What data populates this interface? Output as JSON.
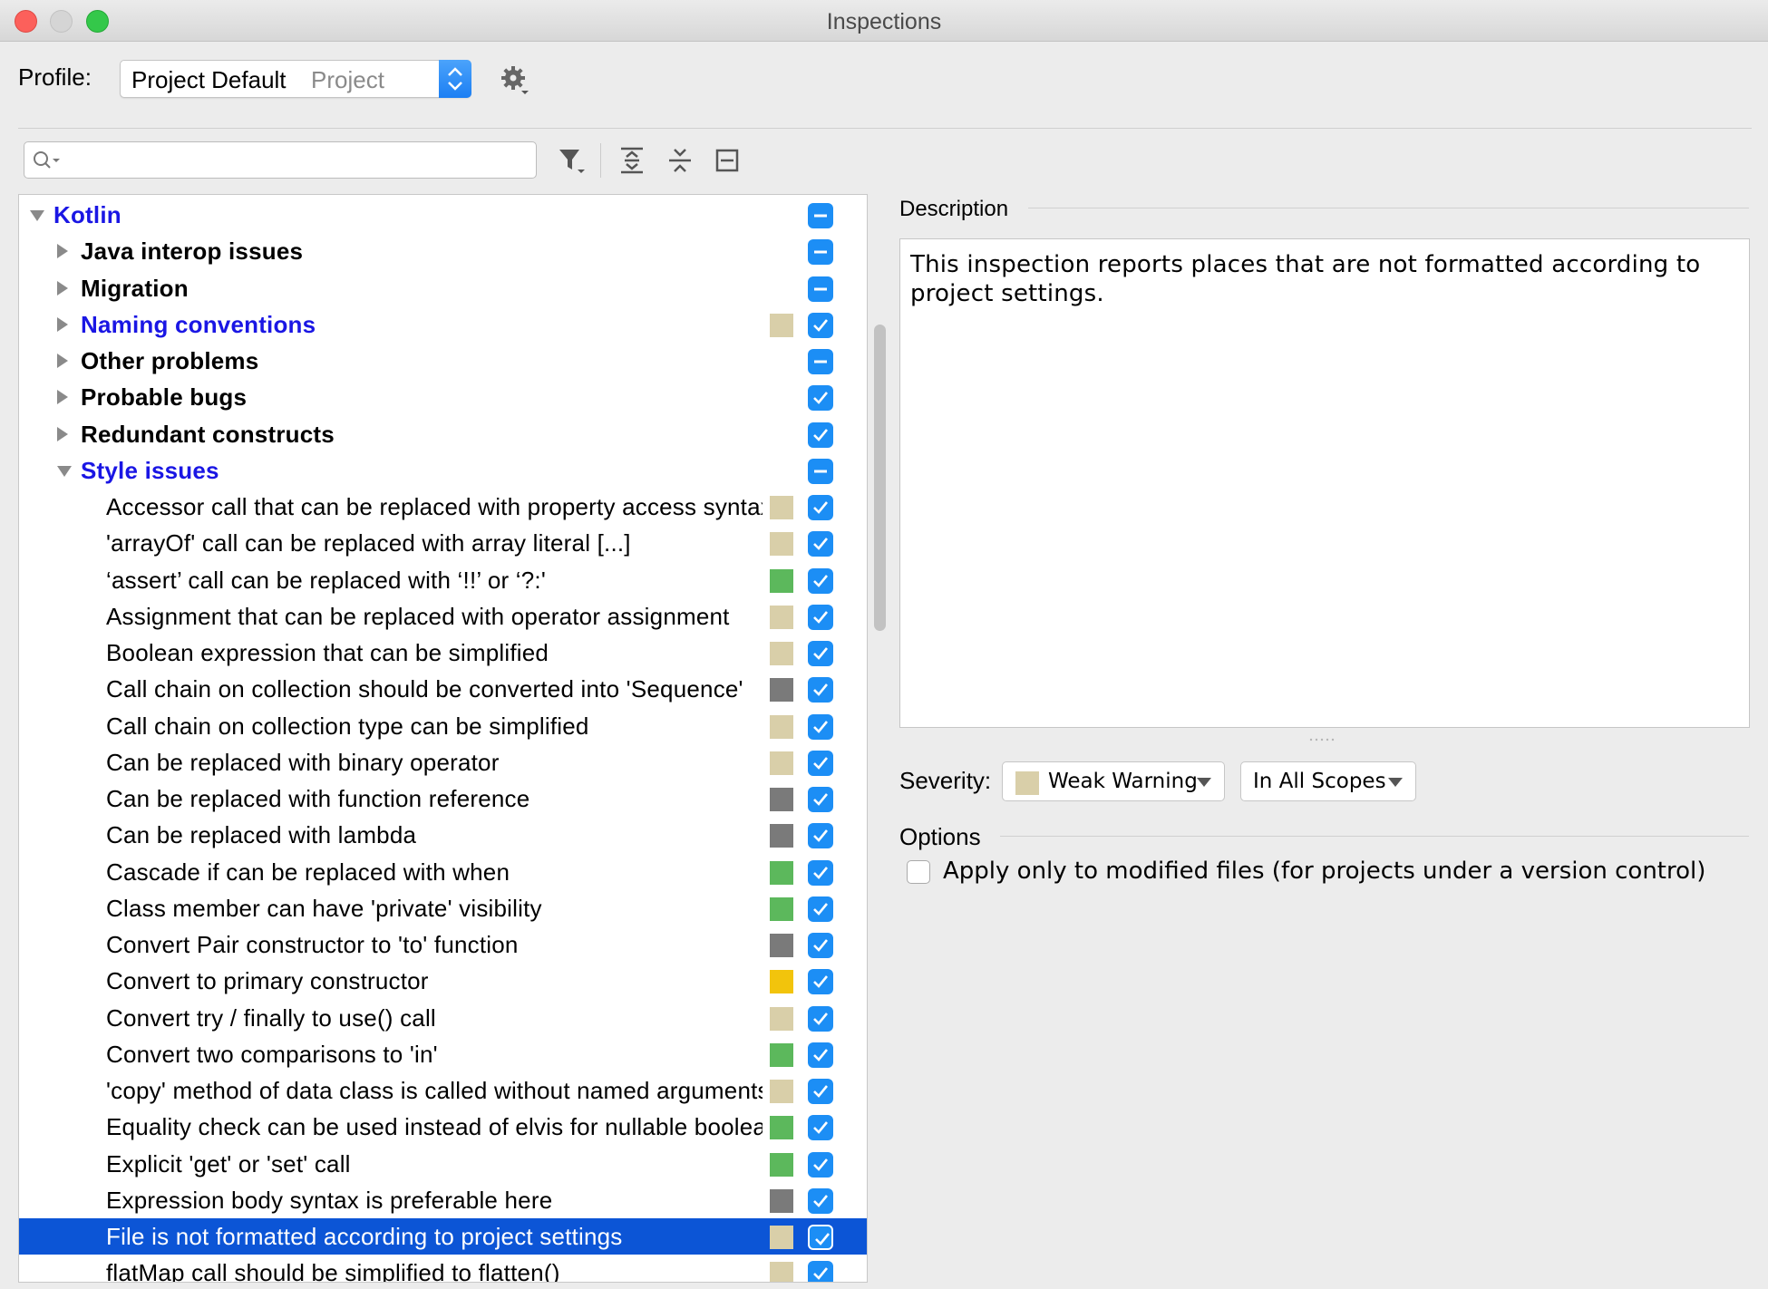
{
  "window": {
    "title": "Inspections"
  },
  "profile": {
    "label": "Profile:",
    "value": "Project Default",
    "scope": "Project"
  },
  "search": {
    "value": "",
    "placeholder": ""
  },
  "icons": {
    "gear": "gear-icon",
    "filter": "filter-icon",
    "expand_all": "expand-all-icon",
    "collapse_all": "collapse-all-icon",
    "reset": "reset-icon"
  },
  "colors": {
    "weak_warning": "#d9cfa9",
    "typo": "#5cb85c",
    "no_highlight": "#7a7a7a",
    "warning": "#f2c40c",
    "checkbox": "#1c8ef5",
    "selection": "#0c55d6",
    "group_blue": "#1a16e4"
  },
  "tree": {
    "rows": [
      {
        "label": "Kotlin",
        "level": 0,
        "arrow": "down",
        "style": "blue",
        "swatch": "",
        "state": "mixed"
      },
      {
        "label": "Java interop issues",
        "level": 1,
        "arrow": "right",
        "style": "group",
        "swatch": "",
        "state": "mixed"
      },
      {
        "label": "Migration",
        "level": 1,
        "arrow": "right",
        "style": "group",
        "swatch": "",
        "state": "mixed"
      },
      {
        "label": "Naming conventions",
        "level": 1,
        "arrow": "right",
        "style": "blue",
        "swatch": "#d9cfa9",
        "state": "checked"
      },
      {
        "label": "Other problems",
        "level": 1,
        "arrow": "right",
        "style": "group",
        "swatch": "",
        "state": "mixed"
      },
      {
        "label": "Probable bugs",
        "level": 1,
        "arrow": "right",
        "style": "group",
        "swatch": "",
        "state": "checked"
      },
      {
        "label": "Redundant constructs",
        "level": 1,
        "arrow": "right",
        "style": "group",
        "swatch": "",
        "state": "checked"
      },
      {
        "label": "Style issues",
        "level": 1,
        "arrow": "down",
        "style": "blue",
        "swatch": "",
        "state": "mixed"
      },
      {
        "label": "Accessor call that can be replaced with property access syntax",
        "level": 2,
        "arrow": "",
        "style": "item",
        "swatch": "#d9cfa9",
        "state": "checked"
      },
      {
        "label": "'arrayOf' call can be replaced with array literal [...]",
        "level": 2,
        "arrow": "",
        "style": "item",
        "swatch": "#d9cfa9",
        "state": "checked"
      },
      {
        "label": "‘assert’ call can be replaced with ‘!!’ or ‘?:'",
        "level": 2,
        "arrow": "",
        "style": "item",
        "swatch": "#5cb85c",
        "state": "checked"
      },
      {
        "label": "Assignment that can be replaced with operator assignment",
        "level": 2,
        "arrow": "",
        "style": "item",
        "swatch": "#d9cfa9",
        "state": "checked"
      },
      {
        "label": "Boolean expression that can be simplified",
        "level": 2,
        "arrow": "",
        "style": "item",
        "swatch": "#d9cfa9",
        "state": "checked"
      },
      {
        "label": "Call chain on collection should be converted into 'Sequence'",
        "level": 2,
        "arrow": "",
        "style": "item",
        "swatch": "#7a7a7a",
        "state": "checked"
      },
      {
        "label": "Call chain on collection type can be simplified",
        "level": 2,
        "arrow": "",
        "style": "item",
        "swatch": "#d9cfa9",
        "state": "checked"
      },
      {
        "label": "Can be replaced with binary operator",
        "level": 2,
        "arrow": "",
        "style": "item",
        "swatch": "#d9cfa9",
        "state": "checked"
      },
      {
        "label": "Can be replaced with function reference",
        "level": 2,
        "arrow": "",
        "style": "item",
        "swatch": "#7a7a7a",
        "state": "checked"
      },
      {
        "label": "Can be replaced with lambda",
        "level": 2,
        "arrow": "",
        "style": "item",
        "swatch": "#7a7a7a",
        "state": "checked"
      },
      {
        "label": "Cascade if can be replaced with when",
        "level": 2,
        "arrow": "",
        "style": "item",
        "swatch": "#5cb85c",
        "state": "checked"
      },
      {
        "label": "Class member can have 'private' visibility",
        "level": 2,
        "arrow": "",
        "style": "item",
        "swatch": "#5cb85c",
        "state": "checked"
      },
      {
        "label": "Convert Pair constructor to 'to' function",
        "level": 2,
        "arrow": "",
        "style": "item",
        "swatch": "#7a7a7a",
        "state": "checked"
      },
      {
        "label": "Convert to primary constructor",
        "level": 2,
        "arrow": "",
        "style": "item",
        "swatch": "#f2c40c",
        "state": "checked"
      },
      {
        "label": "Convert try / finally to use() call",
        "level": 2,
        "arrow": "",
        "style": "item",
        "swatch": "#d9cfa9",
        "state": "checked"
      },
      {
        "label": "Convert two comparisons to 'in'",
        "level": 2,
        "arrow": "",
        "style": "item",
        "swatch": "#5cb85c",
        "state": "checked"
      },
      {
        "label": "'copy' method of data class is called without named arguments",
        "level": 2,
        "arrow": "",
        "style": "item",
        "swatch": "#d9cfa9",
        "state": "checked"
      },
      {
        "label": "Equality check can be used instead of elvis for nullable boolean check",
        "level": 2,
        "arrow": "",
        "style": "item",
        "swatch": "#5cb85c",
        "state": "checked"
      },
      {
        "label": "Explicit 'get' or 'set' call",
        "level": 2,
        "arrow": "",
        "style": "item",
        "swatch": "#5cb85c",
        "state": "checked"
      },
      {
        "label": "Expression body syntax is preferable here",
        "level": 2,
        "arrow": "",
        "style": "item",
        "swatch": "#7a7a7a",
        "state": "checked"
      },
      {
        "label": "File is not formatted according to project settings",
        "level": 2,
        "arrow": "",
        "style": "item",
        "swatch": "#d9cfa9",
        "state": "checked",
        "selected": true
      },
      {
        "label": "flatMap call should be simplified to flatten()",
        "level": 2,
        "arrow": "",
        "style": "item",
        "swatch": "#d9cfa9",
        "state": "checked"
      }
    ]
  },
  "description": {
    "label": "Description",
    "text": "This inspection reports places that are not formatted according to project settings."
  },
  "severity": {
    "label": "Severity:",
    "value": "Weak Warning",
    "swatch": "#d9cfa9",
    "scope": "In All Scopes"
  },
  "options": {
    "label": "Options",
    "checkbox_label": "Apply only to modified files (for projects under a version control)",
    "checked": false
  }
}
